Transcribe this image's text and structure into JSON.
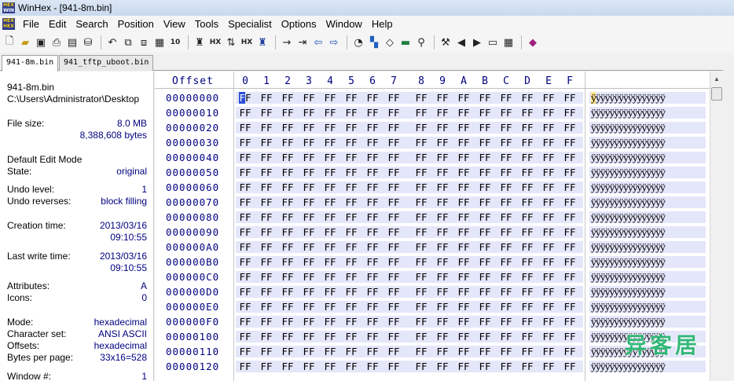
{
  "window": {
    "title": "WinHex - [941-8m.bin]"
  },
  "menu": [
    "File",
    "Edit",
    "Search",
    "Position",
    "View",
    "Tools",
    "Specialist",
    "Options",
    "Window",
    "Help"
  ],
  "toolbar": {
    "icons": [
      "new-file",
      "open-folder",
      "save",
      "print",
      "properties",
      "open-disk",
      "undo",
      "copy",
      "cut",
      "paste",
      "paste-hex",
      "find",
      "find-hex-text",
      "replace",
      "replace-hex",
      "find-next",
      "goto-offset",
      "goto-position",
      "back",
      "forward",
      "calculator",
      "clipboard",
      "disk-editor",
      "ram-editor",
      "search-magnify",
      "tools",
      "play-back",
      "play-forward",
      "snapshot",
      "analysis",
      "help-book"
    ]
  },
  "tabs": [
    {
      "label": "941-8m.bin",
      "active": true
    },
    {
      "label": "941_tftp_uboot.bin",
      "active": false
    }
  ],
  "info": {
    "filename": "941-8m.bin",
    "path": "C:\\Users\\Administrator\\Desktop",
    "file_size_label": "File size:",
    "file_size_mb": "8.0 MB",
    "file_size_bytes": "8,388,608 bytes",
    "edit_mode_label": "Default Edit Mode",
    "state_label": "State:",
    "state_value": "original",
    "undo_level_label": "Undo level:",
    "undo_level_value": "1",
    "undo_reverses_label": "Undo reverses:",
    "undo_reverses_value": "block filling",
    "creation_label": "Creation time:",
    "creation_date": "2013/03/16",
    "creation_time": "09:10:55",
    "lastwrite_label": "Last write time:",
    "lastwrite_date": "2013/03/16",
    "lastwrite_time": "09:10:55",
    "attributes_label": "Attributes:",
    "attributes_value": "A",
    "icons_label": "Icons:",
    "icons_value": "0",
    "mode_label": "Mode:",
    "mode_value": "hexadecimal",
    "charset_label": "Character set:",
    "charset_value": "ANSI ASCII",
    "offsets_label": "Offsets:",
    "offsets_value": "hexadecimal",
    "bpp_label": "Bytes per page:",
    "bpp_value": "33x16=528",
    "window_label": "Window #:",
    "window_value": "1"
  },
  "hex": {
    "offset_header": "Offset",
    "columns": [
      "0",
      "1",
      "2",
      "3",
      "4",
      "5",
      "6",
      "7",
      "8",
      "9",
      "A",
      "B",
      "C",
      "D",
      "E",
      "F"
    ],
    "rows": [
      {
        "offset": "00000000",
        "bytes": [
          "FF",
          "FF",
          "FF",
          "FF",
          "FF",
          "FF",
          "FF",
          "FF",
          "FF",
          "FF",
          "FF",
          "FF",
          "FF",
          "FF",
          "FF",
          "FF"
        ],
        "ascii": "ÿÿÿÿÿÿÿÿÿÿÿÿÿÿÿÿ"
      },
      {
        "offset": "00000010",
        "bytes": [
          "FF",
          "FF",
          "FF",
          "FF",
          "FF",
          "FF",
          "FF",
          "FF",
          "FF",
          "FF",
          "FF",
          "FF",
          "FF",
          "FF",
          "FF",
          "FF"
        ],
        "ascii": "ÿÿÿÿÿÿÿÿÿÿÿÿÿÿÿÿ"
      },
      {
        "offset": "00000020",
        "bytes": [
          "FF",
          "FF",
          "FF",
          "FF",
          "FF",
          "FF",
          "FF",
          "FF",
          "FF",
          "FF",
          "FF",
          "FF",
          "FF",
          "FF",
          "FF",
          "FF"
        ],
        "ascii": "ÿÿÿÿÿÿÿÿÿÿÿÿÿÿÿÿ"
      },
      {
        "offset": "00000030",
        "bytes": [
          "FF",
          "FF",
          "FF",
          "FF",
          "FF",
          "FF",
          "FF",
          "FF",
          "FF",
          "FF",
          "FF",
          "FF",
          "FF",
          "FF",
          "FF",
          "FF"
        ],
        "ascii": "ÿÿÿÿÿÿÿÿÿÿÿÿÿÿÿÿ"
      },
      {
        "offset": "00000040",
        "bytes": [
          "FF",
          "FF",
          "FF",
          "FF",
          "FF",
          "FF",
          "FF",
          "FF",
          "FF",
          "FF",
          "FF",
          "FF",
          "FF",
          "FF",
          "FF",
          "FF"
        ],
        "ascii": "ÿÿÿÿÿÿÿÿÿÿÿÿÿÿÿÿ"
      },
      {
        "offset": "00000050",
        "bytes": [
          "FF",
          "FF",
          "FF",
          "FF",
          "FF",
          "FF",
          "FF",
          "FF",
          "FF",
          "FF",
          "FF",
          "FF",
          "FF",
          "FF",
          "FF",
          "FF"
        ],
        "ascii": "ÿÿÿÿÿÿÿÿÿÿÿÿÿÿÿÿ"
      },
      {
        "offset": "00000060",
        "bytes": [
          "FF",
          "FF",
          "FF",
          "FF",
          "FF",
          "FF",
          "FF",
          "FF",
          "FF",
          "FF",
          "FF",
          "FF",
          "FF",
          "FF",
          "FF",
          "FF"
        ],
        "ascii": "ÿÿÿÿÿÿÿÿÿÿÿÿÿÿÿÿ"
      },
      {
        "offset": "00000070",
        "bytes": [
          "FF",
          "FF",
          "FF",
          "FF",
          "FF",
          "FF",
          "FF",
          "FF",
          "FF",
          "FF",
          "FF",
          "FF",
          "FF",
          "FF",
          "FF",
          "FF"
        ],
        "ascii": "ÿÿÿÿÿÿÿÿÿÿÿÿÿÿÿÿ"
      },
      {
        "offset": "00000080",
        "bytes": [
          "FF",
          "FF",
          "FF",
          "FF",
          "FF",
          "FF",
          "FF",
          "FF",
          "FF",
          "FF",
          "FF",
          "FF",
          "FF",
          "FF",
          "FF",
          "FF"
        ],
        "ascii": "ÿÿÿÿÿÿÿÿÿÿÿÿÿÿÿÿ"
      },
      {
        "offset": "00000090",
        "bytes": [
          "FF",
          "FF",
          "FF",
          "FF",
          "FF",
          "FF",
          "FF",
          "FF",
          "FF",
          "FF",
          "FF",
          "FF",
          "FF",
          "FF",
          "FF",
          "FF"
        ],
        "ascii": "ÿÿÿÿÿÿÿÿÿÿÿÿÿÿÿÿ"
      },
      {
        "offset": "000000A0",
        "bytes": [
          "FF",
          "FF",
          "FF",
          "FF",
          "FF",
          "FF",
          "FF",
          "FF",
          "FF",
          "FF",
          "FF",
          "FF",
          "FF",
          "FF",
          "FF",
          "FF"
        ],
        "ascii": "ÿÿÿÿÿÿÿÿÿÿÿÿÿÿÿÿ"
      },
      {
        "offset": "000000B0",
        "bytes": [
          "FF",
          "FF",
          "FF",
          "FF",
          "FF",
          "FF",
          "FF",
          "FF",
          "FF",
          "FF",
          "FF",
          "FF",
          "FF",
          "FF",
          "FF",
          "FF"
        ],
        "ascii": "ÿÿÿÿÿÿÿÿÿÿÿÿÿÿÿÿ"
      },
      {
        "offset": "000000C0",
        "bytes": [
          "FF",
          "FF",
          "FF",
          "FF",
          "FF",
          "FF",
          "FF",
          "FF",
          "FF",
          "FF",
          "FF",
          "FF",
          "FF",
          "FF",
          "FF",
          "FF"
        ],
        "ascii": "ÿÿÿÿÿÿÿÿÿÿÿÿÿÿÿÿ"
      },
      {
        "offset": "000000D0",
        "bytes": [
          "FF",
          "FF",
          "FF",
          "FF",
          "FF",
          "FF",
          "FF",
          "FF",
          "FF",
          "FF",
          "FF",
          "FF",
          "FF",
          "FF",
          "FF",
          "FF"
        ],
        "ascii": "ÿÿÿÿÿÿÿÿÿÿÿÿÿÿÿÿ"
      },
      {
        "offset": "000000E0",
        "bytes": [
          "FF",
          "FF",
          "FF",
          "FF",
          "FF",
          "FF",
          "FF",
          "FF",
          "FF",
          "FF",
          "FF",
          "FF",
          "FF",
          "FF",
          "FF",
          "FF"
        ],
        "ascii": "ÿÿÿÿÿÿÿÿÿÿÿÿÿÿÿÿ"
      },
      {
        "offset": "000000F0",
        "bytes": [
          "FF",
          "FF",
          "FF",
          "FF",
          "FF",
          "FF",
          "FF",
          "FF",
          "FF",
          "FF",
          "FF",
          "FF",
          "FF",
          "FF",
          "FF",
          "FF"
        ],
        "ascii": "ÿÿÿÿÿÿÿÿÿÿÿÿÿÿÿÿ"
      },
      {
        "offset": "00000100",
        "bytes": [
          "FF",
          "FF",
          "FF",
          "FF",
          "FF",
          "FF",
          "FF",
          "FF",
          "FF",
          "FF",
          "FF",
          "FF",
          "FF",
          "FF",
          "FF",
          "FF"
        ],
        "ascii": "ÿÿÿÿÿÿÿÿÿÿÿÿÿÿÿÿ"
      },
      {
        "offset": "00000110",
        "bytes": [
          "FF",
          "FF",
          "FF",
          "FF",
          "FF",
          "FF",
          "FF",
          "FF",
          "FF",
          "FF",
          "FF",
          "FF",
          "FF",
          "FF",
          "FF",
          "FF"
        ],
        "ascii": "ÿÿÿÿÿÿÿÿÿÿÿÿÿÿÿÿ"
      },
      {
        "offset": "00000120",
        "bytes": [
          "FF",
          "FF",
          "FF",
          "FF",
          "FF",
          "FF",
          "FF",
          "FF",
          "FF",
          "FF",
          "FF",
          "FF",
          "FF",
          "FF",
          "FF",
          "FF"
        ],
        "ascii": "ÿÿÿÿÿÿÿÿÿÿÿÿÿÿÿÿ"
      }
    ],
    "cursor": {
      "row": 0,
      "col": 0
    }
  },
  "watermark": "异客居",
  "colors": {
    "offset_text": "#000080",
    "row_band": "#e4e6fa",
    "cursor": "#2a4cd8",
    "info_value": "#000080",
    "watermark": "#2bb673"
  }
}
